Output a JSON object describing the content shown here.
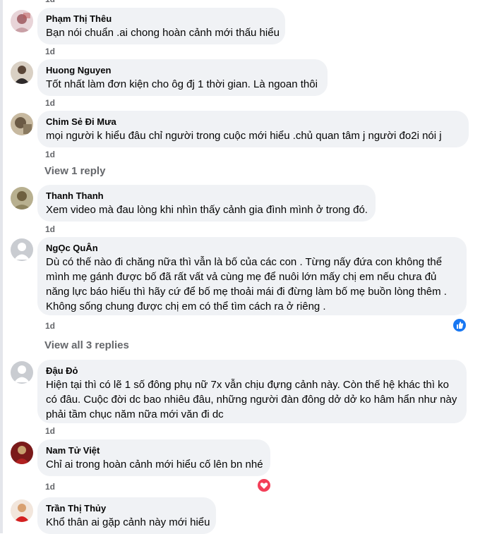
{
  "comments": [
    {
      "author": "Phạm Thị Thêu",
      "lines": [
        "Bạn nói chuẩn .ai chong hoàn cảnh mới thấu hiểu"
      ],
      "time": "1d"
    },
    {
      "author": "Huong Nguyen",
      "lines": [
        "Tốt nhất làm đơn kiện cho ôg đj 1 thời gian. Là ngoan thôi"
      ],
      "time": "1d"
    },
    {
      "author": "Chim Sẻ Đi Mưa",
      "lines": [
        "mọi người k hiểu đâu chỉ người trong cuộc mới hiểu .chủ quan tâm j người đo2i nói j"
      ],
      "time": "1d",
      "replies": "View 1 reply"
    },
    {
      "author": "Thanh Thanh",
      "lines": [
        "Xem video mà đau lòng khi nhìn thấy cảnh gia đình mình ở trong đó."
      ],
      "time": "1d"
    },
    {
      "author": "NgỌc QuÂn",
      "lines": [
        "Dù có thế nào đi chăng nữa thì vẫn là bố của các con . Từng nấy đứa con không thể",
        "mình mẹ gánh được bố đã rất vất vả cùng mẹ để nuôi lớn mấy chị em nếu chưa đủ",
        "năng lực báo hiếu thì hãy cứ để bố mẹ thoải mái đi đừng làm bố mẹ buồn lòng thêm .",
        "Không sống chung được chị em có thể tìm cách ra ở riêng ."
      ],
      "time": "1d",
      "replies": "View all 3 replies",
      "reaction": "like"
    },
    {
      "author": "Đậu Đỏ",
      "lines": [
        "Hiện tại thì có lẽ 1 số đông phụ nữ 7x vẫn chịu đựng cảnh này. Còn thế hệ khác thì ko",
        "có đâu. Cuộc đời dc bao nhiêu đâu, những người đàn đông dở dở ko hâm hẩn như này",
        "phải tầm chục năm nữa mới văn đi dc"
      ],
      "time": "1d"
    },
    {
      "author": "Nam Tử Việt",
      "lines": [
        "Chỉ ai trong hoàn cảnh mới hiểu cố lên bn nhé"
      ],
      "time": "1d",
      "reaction": "love"
    },
    {
      "author": "Trần Thị Thủy",
      "lines": [
        "Khổ thân ai gặp cảnh này mới hiểu"
      ]
    }
  ],
  "top_time": "1d",
  "colors": {
    "bubble": "#f0f2f5",
    "meta": "#65676b",
    "like": "#1877f2",
    "love": "#f33e58"
  }
}
